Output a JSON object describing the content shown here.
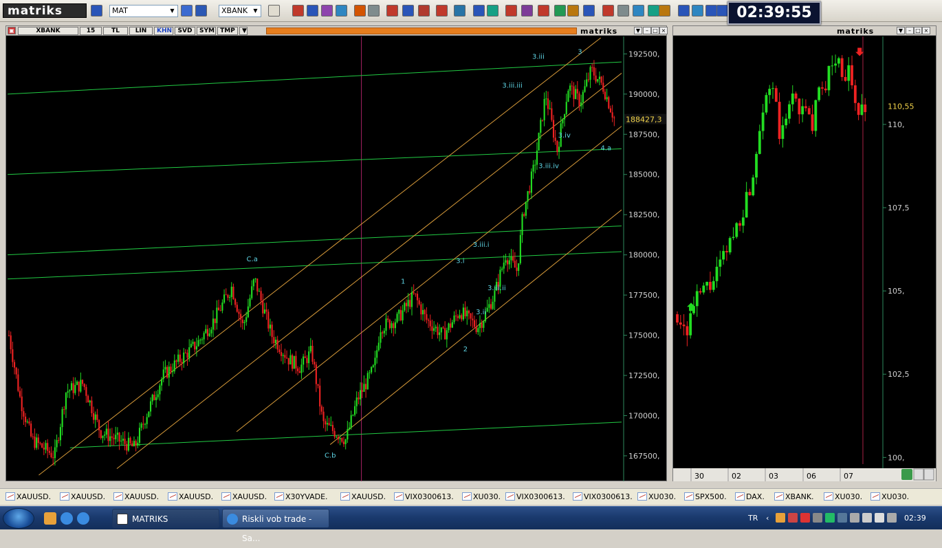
{
  "app": {
    "logo_text": "matriks"
  },
  "toolbar": {
    "left_combo": "MAT",
    "symbol_combo": "XBANK",
    "clock": "02:39:55"
  },
  "main_panel": {
    "buttons": [
      "XBANK",
      "15",
      "TL",
      "LIN",
      "KHN",
      "SVD",
      "SYM",
      "TMP"
    ],
    "active_button": "KHN",
    "brand": "matriks",
    "price_label": "188427,3",
    "y_ticks": [
      "192500,",
      "190000,",
      "187500,",
      "185000,",
      "182500,",
      "180000,",
      "177500,",
      "175000,",
      "172500,",
      "170000,",
      "167500,"
    ],
    "wave_labels": [
      "3.iii",
      "3",
      "3.iii.iii",
      "3.iv",
      "4.a",
      "3.iii.iv",
      "1",
      "3.iii.i",
      "3.i",
      "3.iii.ii",
      "3.ii",
      "2",
      "C.a",
      "C.b"
    ]
  },
  "side_panel": {
    "brand": "matriks",
    "price_label": "110,55",
    "y_ticks": [
      "110,",
      "107,5",
      "105,",
      "102,5",
      "100,"
    ],
    "x_ticks": [
      "30",
      "02",
      "03",
      "06",
      "07"
    ]
  },
  "chart_data": [
    {
      "type": "candlestick",
      "symbol": "XBANK",
      "period": "15",
      "ylim": [
        166000,
        193500
      ],
      "y_ticks": [
        192500,
        190000,
        187500,
        185000,
        182500,
        180000,
        177500,
        175000,
        172500,
        170000,
        167500
      ],
      "last_price": 188427.3,
      "up_color": "#22dd22",
      "down_color": "#ee2222",
      "close_path": [
        [
          0,
          175000
        ],
        [
          2,
          171000
        ],
        [
          4,
          168500
        ],
        [
          6,
          168000
        ],
        [
          8,
          167500
        ],
        [
          10,
          171500
        ],
        [
          13,
          172000
        ],
        [
          16,
          169000
        ],
        [
          19,
          168500
        ],
        [
          22,
          168000
        ],
        [
          24,
          170000
        ],
        [
          27,
          172500
        ],
        [
          30,
          173500
        ],
        [
          33,
          174500
        ],
        [
          36,
          176000
        ],
        [
          39,
          178000
        ],
        [
          41,
          175500
        ],
        [
          43,
          178500
        ],
        [
          46,
          175000
        ],
        [
          49,
          173500
        ],
        [
          51,
          173000
        ],
        [
          53,
          174000
        ],
        [
          55,
          169500
        ],
        [
          57,
          169000
        ],
        [
          59,
          168500
        ],
        [
          61,
          171000
        ],
        [
          64,
          173000
        ],
        [
          65,
          175500
        ],
        [
          68,
          176000
        ],
        [
          71,
          177500
        ],
        [
          73,
          176000
        ],
        [
          76,
          175000
        ],
        [
          79,
          176500
        ],
        [
          82,
          175500
        ],
        [
          83,
          176000
        ],
        [
          85,
          177500
        ],
        [
          87,
          180000
        ],
        [
          89,
          179000
        ],
        [
          90,
          182500
        ],
        [
          92,
          185500
        ],
        [
          94,
          190000
        ],
        [
          96,
          186500
        ],
        [
          98,
          190500
        ],
        [
          100,
          189500
        ],
        [
          102,
          191500
        ],
        [
          104,
          190500
        ],
        [
          106,
          188500
        ]
      ],
      "wave_labels": [
        {
          "t": "3.iii",
          "x": 102,
          "y": 192200
        },
        {
          "t": "3",
          "x": 110,
          "y": 192500
        },
        {
          "t": "3.iii.iii",
          "x": 97,
          "y": 190400
        },
        {
          "t": "3.iv",
          "x": 107,
          "y": 187300
        },
        {
          "t": "4.a",
          "x": 115,
          "y": 186500
        },
        {
          "t": "3.iii.iv",
          "x": 104,
          "y": 185400
        },
        {
          "t": "1",
          "x": 76,
          "y": 178200
        },
        {
          "t": "3.iii.i",
          "x": 91,
          "y": 180500
        },
        {
          "t": "3.i",
          "x": 87,
          "y": 179500
        },
        {
          "t": "3.iii.ii",
          "x": 94,
          "y": 177800
        },
        {
          "t": "3.ii",
          "x": 91,
          "y": 176300
        },
        {
          "t": "2",
          "x": 88,
          "y": 174000
        },
        {
          "t": "C.a",
          "x": 47,
          "y": 179600
        },
        {
          "t": "C.b",
          "x": 62,
          "y": 167400
        }
      ],
      "channels": [
        {
          "color": "#22cc44",
          "p1": [
            0,
            190000
          ],
          "p2": [
            118,
            192000
          ]
        },
        {
          "color": "#22cc44",
          "p1": [
            0,
            185000
          ],
          "p2": [
            118,
            186600
          ]
        },
        {
          "color": "#22cc44",
          "p1": [
            0,
            180000
          ],
          "p2": [
            118,
            181800
          ]
        },
        {
          "color": "#22cc44",
          "p1": [
            0,
            178500
          ],
          "p2": [
            118,
            180200
          ]
        },
        {
          "color": "#22cc44",
          "p1": [
            12,
            168000
          ],
          "p2": [
            118,
            169600
          ]
        },
        {
          "color": "#d89b3a",
          "p1": [
            6,
            166300
          ],
          "p2": [
            114,
            193500
          ]
        },
        {
          "color": "#d89b3a",
          "p1": [
            21,
            166700
          ],
          "p2": [
            118,
            191300
          ]
        },
        {
          "color": "#d89b3a",
          "p1": [
            44,
            169000
          ],
          "p2": [
            118,
            188000
          ]
        },
        {
          "color": "#d89b3a",
          "p1": [
            62,
            168200
          ],
          "p2": [
            118,
            182800
          ]
        }
      ],
      "vlines": [
        {
          "x": 68,
          "color": "#aa2266"
        }
      ]
    },
    {
      "type": "candlestick",
      "ylim": [
        99800,
        112600
      ],
      "y_ticks": [
        110,
        107.5,
        105,
        102.5,
        100
      ],
      "x_ticks": [
        "30",
        "02",
        "03",
        "06",
        "07"
      ],
      "last_price": 110.55,
      "close_path": [
        [
          0,
          104.3
        ],
        [
          3,
          103.8
        ],
        [
          5,
          104.5
        ],
        [
          8,
          105
        ],
        [
          11,
          105.2
        ],
        [
          14,
          105.8
        ],
        [
          17,
          106.5
        ],
        [
          20,
          107.2
        ],
        [
          23,
          108
        ],
        [
          25,
          109
        ],
        [
          27,
          110.5
        ],
        [
          29,
          111.2
        ],
        [
          31,
          110.8
        ],
        [
          33,
          109.5
        ],
        [
          35,
          110.2
        ],
        [
          37,
          111
        ],
        [
          39,
          110.5
        ],
        [
          41,
          110.3
        ],
        [
          43,
          110
        ],
        [
          45,
          110.8
        ],
        [
          47,
          111.2
        ],
        [
          49,
          111.7
        ],
        [
          51,
          112
        ],
        [
          53,
          111.5
        ],
        [
          55,
          111.6
        ],
        [
          56,
          110.8
        ],
        [
          58,
          110.3
        ],
        [
          60,
          110.6
        ]
      ],
      "signals": [
        {
          "type": "buy",
          "x": 5,
          "y": 104.4
        },
        {
          "type": "sell",
          "x": 56,
          "y": 112.3
        }
      ],
      "vlines": [
        {
          "x": 57,
          "color": "#aa2244"
        }
      ]
    }
  ],
  "symbol_tabs": [
    "XAUUSD.",
    "XAUUSD.",
    "XAUUSD.",
    "XAUUSD.",
    "XAUUSD.",
    "X30YVADE.",
    "XAUUSD.",
    "VIX0300613.",
    "XU030.",
    "VIX0300613.",
    "VIX0300613.",
    "XU030.",
    "SPX500.",
    "DAX.",
    "XBANK.",
    "XU030.",
    "XU030."
  ],
  "taskbar": {
    "tasks": [
      "MATRIKS",
      "Riskli vob trade - Sa..."
    ],
    "lang": "TR",
    "time": "02:39"
  }
}
